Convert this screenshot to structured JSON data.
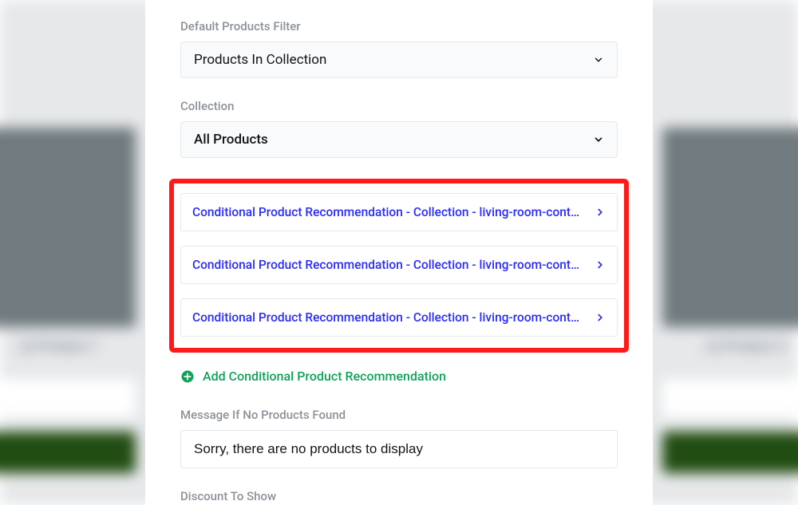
{
  "background": {
    "left_label": "…fy Product 1",
    "right_label": "…fy Product 3"
  },
  "filter": {
    "label": "Default Products Filter",
    "value": "Products In Collection"
  },
  "collection": {
    "label": "Collection",
    "value": "All Products"
  },
  "conditional_items": [
    {
      "label": "Conditional Product Recommendation - Collection - living-room-cont…"
    },
    {
      "label": "Conditional Product Recommendation - Collection - living-room-cont…"
    },
    {
      "label": "Conditional Product Recommendation - Collection - living-room-cont…"
    }
  ],
  "add_button": {
    "label": "Add Conditional Product Recommendation"
  },
  "no_products": {
    "label": "Message If No Products Found",
    "value": "Sorry, there are no products to display"
  },
  "discount": {
    "label": "Discount To Show"
  }
}
